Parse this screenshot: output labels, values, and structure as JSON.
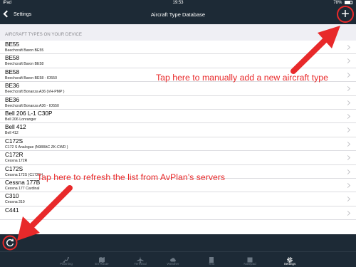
{
  "status_bar": {
    "device": "iPad",
    "time": "19:53",
    "battery": "78%"
  },
  "nav": {
    "back_label": "Settings",
    "title": "Aircraft Type Database",
    "add_symbol": "+"
  },
  "section_header": "AIRCRAFT TYPES ON YOUR DEVICE",
  "aircraft": [
    {
      "code": "BE55",
      "name": "Beechcraft Baron BE55"
    },
    {
      "code": "BE58",
      "name": "Beechcraft Baron BE58"
    },
    {
      "code": "BE58",
      "name": "Beechcraft Baron BE58 - IO550"
    },
    {
      "code": "BE36",
      "name": "Beechcraft Bonanza A36 (VH-PMP )"
    },
    {
      "code": "BE36",
      "name": "Beechcraft Bonanza A36 - IO550"
    },
    {
      "code": "Bell 206 L-1 C30P",
      "name": "Bell 206 Lonranger"
    },
    {
      "code": "Bell 412",
      "name": "Bell 412"
    },
    {
      "code": "C172S",
      "name": "C172 S Analogue (N988AC ZK-CWD )"
    },
    {
      "code": "C172R",
      "name": "Cessna 172R"
    },
    {
      "code": "C172S",
      "name": "Cessna 172S (C172S )"
    },
    {
      "code": "Cessna 177B",
      "name": "Cessna 177 Cardinal"
    },
    {
      "code": "C310",
      "name": "Cessna 310"
    },
    {
      "code": "C441",
      "name": ""
    }
  ],
  "tabs": [
    {
      "label": "Planning",
      "icon": "route-icon"
    },
    {
      "label": "En Route",
      "icon": "map-icon"
    },
    {
      "label": "Terminal",
      "icon": "plane-icon"
    },
    {
      "label": "Weather",
      "icon": "cloud-icon"
    },
    {
      "label": "Text",
      "icon": "document-icon"
    },
    {
      "label": "Notepad",
      "icon": "notepad-icon"
    },
    {
      "label": "Settings",
      "icon": "gear-icon",
      "active": true
    }
  ],
  "annotations": {
    "add_hint": "Tap here to manually add a new aircraft type",
    "refresh_hint": "Tap here to refresh the list from AvPlan’s servers"
  },
  "colors": {
    "bar": "#1d2a36",
    "annotation": "#e8292a",
    "active_tab": "#ffffff",
    "inactive_tab": "#6c7884"
  }
}
